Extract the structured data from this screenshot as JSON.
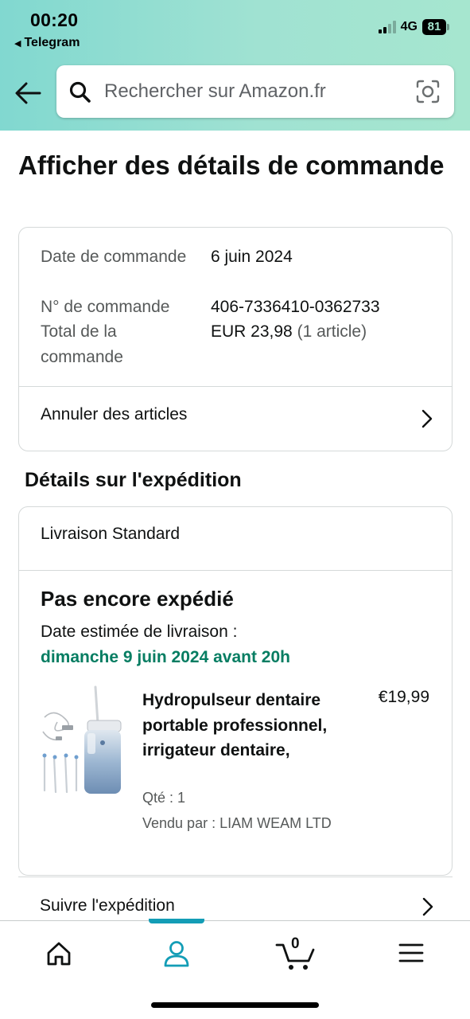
{
  "status_bar": {
    "time": "00:20",
    "back_app": "Telegram",
    "network": "4G",
    "battery": "81"
  },
  "search": {
    "placeholder": "Rechercher sur Amazon.fr"
  },
  "page_title": "Afficher des détails de commande",
  "order": {
    "date_label": "Date de commande",
    "date_value": "6 juin 2024",
    "number_label": "N° de commande",
    "number_value": "406-7336410-0362733",
    "total_label": "Total de la commande",
    "total_value": "EUR 23,98",
    "total_items": "(1 article)",
    "cancel_label": "Annuler des articles"
  },
  "shipping": {
    "section_title": "Détails sur l'expédition",
    "method": "Livraison Standard",
    "status": "Pas encore expédié",
    "eta_label": "Date estimée de livraison :",
    "eta_date": "dimanche 9 juin 2024 avant 20h",
    "track_label": "Suivre l'expédition"
  },
  "product": {
    "title": "Hydropulseur dentaire portable professionnel, irrigateur dentaire,",
    "price": "€19,99",
    "qty": "Qté : 1",
    "seller": "Vendu par : LIAM WEAM LTD"
  },
  "bottom_nav": {
    "cart_count": "0",
    "items": [
      "home-icon",
      "account-icon",
      "cart-icon",
      "menu-icon"
    ],
    "active": "account-icon"
  },
  "colors": {
    "header_gradient_start": "#81d8d0",
    "header_gradient_end": "#a6e6cf",
    "eta_green": "#067d62",
    "nav_active": "#139db6"
  }
}
